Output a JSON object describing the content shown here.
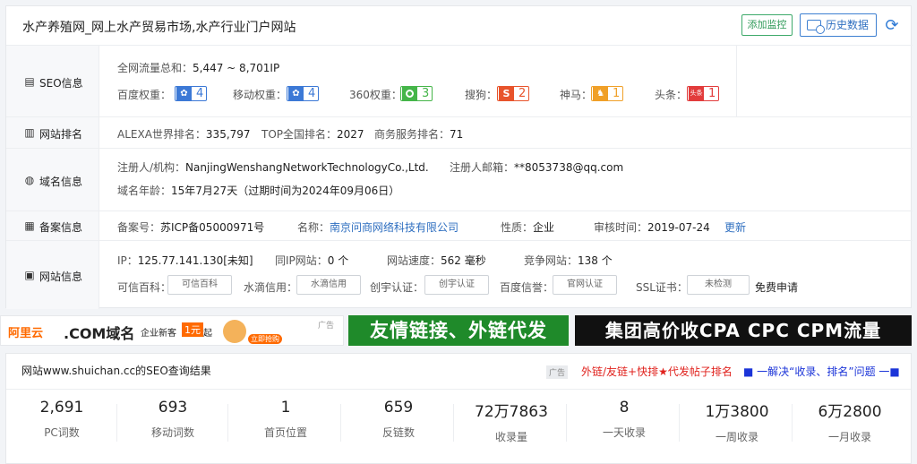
{
  "header": {
    "title": "水产养殖网_网上水产贸易市场,水产行业门户网站",
    "monitor_label": "添加监控",
    "history_label": "历史数据"
  },
  "seo": {
    "label": "SEO信息",
    "traffic_label": "全网流量总和：",
    "traffic_value": "5,447 ~ 8,701IP",
    "baidu_label": "百度权重：",
    "baidu_value": "4",
    "mobile_label": "移动权重：",
    "mobile_value": "4",
    "s360_label": "360权重：",
    "s360_value": "3",
    "sogou_label": "搜狗：",
    "sogou_value": "2",
    "shenma_label": "神马：",
    "shenma_value": "1",
    "toutiao_label": "头条：",
    "toutiao_value": "1",
    "toutiao_logo": "头条",
    "colors": {
      "baidu": "#3c79d6",
      "s360": "#45b549",
      "sogou": "#e8542c",
      "shenma": "#f0a028",
      "toutiao": "#e23c3c"
    }
  },
  "rank": {
    "label": "网站排名",
    "alexa": "ALEXA世界排名：",
    "alexa_value": "335,797",
    "top": "TOP全国排名：",
    "top_value": "2027",
    "biz": "商务服务排名：",
    "biz_value": "71"
  },
  "domain": {
    "label": "域名信息",
    "registrant_label": "注册人/机构：",
    "registrant_value": "NanjingWenshangNetworkTechnologyCo.,Ltd.",
    "email_label": "注册人邮箱：",
    "email_value": "**8053738@qq.com",
    "age_label": "域名年龄：",
    "age_value": "15年7月27天（过期时间为2024年09月06日）"
  },
  "beian": {
    "label": "备案信息",
    "no_label": "备案号：",
    "no_value": "苏ICP备05000971号",
    "name_label": "名称：",
    "name_value": "南京问商网络科技有限公司",
    "type_label": "性质：",
    "type_value": "企业",
    "date_label": "审核时间：",
    "date_value": "2019-07-24",
    "update_label": "更新"
  },
  "site": {
    "label": "网站信息",
    "ip_label": "IP：",
    "ip_value": "125.77.141.130[未知]",
    "sameip_label": "同IP网站：",
    "sameip_value": "0 个",
    "speed_label": "网站速度：",
    "speed_value": "562 毫秒",
    "compete_label": "竞争网站：",
    "compete_value": "138 个",
    "kexin_label": "可信百科：",
    "kexin_badge": "可信百科",
    "shuidi_label": "水滴信用：",
    "shuidi_badge": "水滴信用",
    "chuangyu_label": "创宇认证：",
    "chuangyu_badge": "创宇认证",
    "baidu_label": "百度信誉：",
    "baidu_badge": "官网认证",
    "ssl_label": "SSL证书：",
    "ssl_badge": "未检测",
    "ssl_apply": "免费申请"
  },
  "ads": {
    "ad1_brand": "阿里云",
    "ad1_text": ".COM域名",
    "ad1_sub": "企业新客",
    "ad1_price": "1元",
    "ad1_unit": "起",
    "ad1_btn": "立即抢购",
    "ad_tag": "广告",
    "ad2_text": "友情链接、外链代发",
    "ad3_text": "集团高价收CPA CPC CPM流量"
  },
  "result": {
    "title": "网站www.shuichan.cc的SEO查询结果",
    "ad_tag": "广告",
    "link1": "外链/友链+快排★代发帖子排名",
    "link2": "■ 一解决“收录、排名”问题 一■",
    "stats": [
      {
        "value": "2,691",
        "label": "PC词数"
      },
      {
        "value": "693",
        "label": "移动词数"
      },
      {
        "value": "1",
        "label": "首页位置"
      },
      {
        "value": "659",
        "label": "反链数"
      },
      {
        "value": "72万7863",
        "label": "收录量"
      },
      {
        "value": "8",
        "label": "一天收录"
      },
      {
        "value": "1万3800",
        "label": "一周收录"
      },
      {
        "value": "6万2800",
        "label": "一月收录"
      }
    ]
  }
}
